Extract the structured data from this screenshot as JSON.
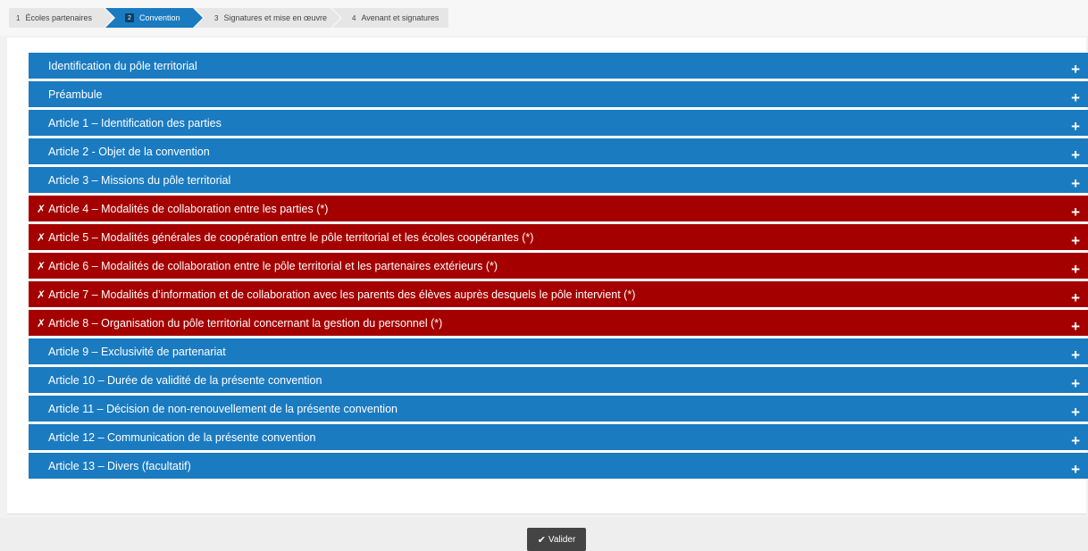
{
  "stepper": {
    "steps": [
      {
        "num": "1",
        "label": "Écoles partenaires"
      },
      {
        "num": "2",
        "label": "Convention"
      },
      {
        "num": "3",
        "label": "Signatures et mise en œuvre"
      },
      {
        "num": "4",
        "label": "Avenant et signatures"
      }
    ],
    "active_step": "2"
  },
  "accordion": {
    "expand_icon": "+",
    "error_icon": "✗",
    "rows": [
      {
        "label": "Identification du pôle territorial",
        "status": "ok"
      },
      {
        "label": "Préambule",
        "status": "ok"
      },
      {
        "label": "Article 1 – Identification des parties",
        "status": "ok"
      },
      {
        "label": "Article 2 - Objet de la convention",
        "status": "ok"
      },
      {
        "label": "Article 3 – Missions du pôle territorial",
        "status": "ok"
      },
      {
        "label": "Article 4 – Modalités de collaboration entre les parties (*)",
        "status": "error"
      },
      {
        "label": "Article 5 – Modalités générales de coopération entre le pôle territorial et les écoles coopérantes (*)",
        "status": "error"
      },
      {
        "label": "Article 6 – Modalités de collaboration entre le pôle territorial et les partenaires extérieurs (*)",
        "status": "error"
      },
      {
        "label": "Article 7 – Modalités d’information et de collaboration avec les parents des élèves auprès desquels le pôle intervient (*)",
        "status": "error"
      },
      {
        "label": "Article 8 – Organisation du pôle territorial concernant la gestion du personnel (*)",
        "status": "error"
      },
      {
        "label": "Article 9 – Exclusivité de partenariat",
        "status": "ok"
      },
      {
        "label": "Article 10 – Durée de validité de la présente convention",
        "status": "ok"
      },
      {
        "label": "Article 11 – Décision de non-renouvellement de la présente convention",
        "status": "ok"
      },
      {
        "label": "Article 12 – Communication de la présente convention",
        "status": "ok"
      },
      {
        "label": "Article 13 – Divers (facultatif)",
        "status": "ok"
      }
    ]
  },
  "footer": {
    "validate_label": "Valider",
    "validate_icon": "✔"
  },
  "colors": {
    "ok_row": "#1a7bc1",
    "error_row": "#a50000",
    "active_step": "#1a7bc1"
  }
}
